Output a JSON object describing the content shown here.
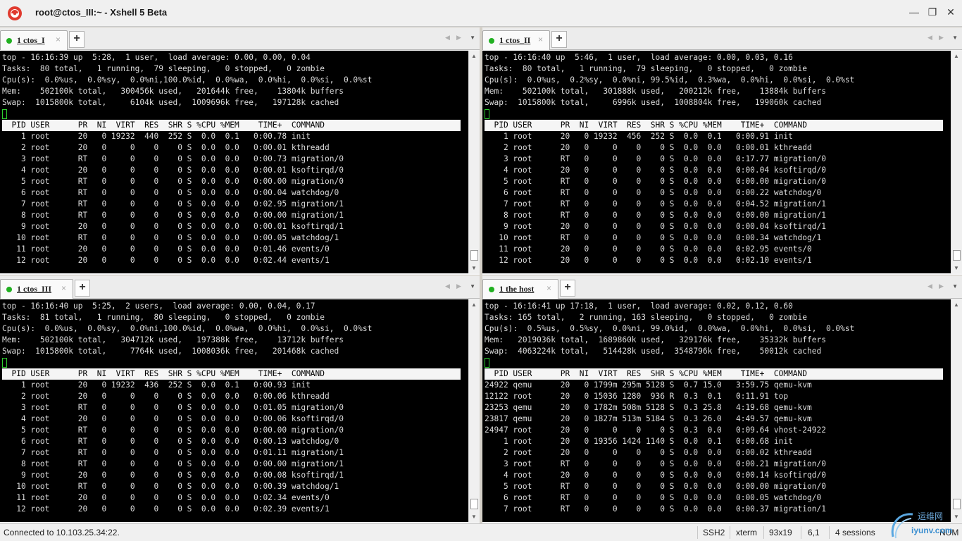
{
  "window": {
    "title": "root@ctos_III:~ - Xshell 5 Beta",
    "controls": {
      "minimize": "—",
      "restore": "❐",
      "close": "✕"
    }
  },
  "panes": [
    {
      "tab": {
        "label": "1 ctos_I",
        "close": "×",
        "add": "+"
      },
      "header": [
        "top - 16:16:39 up  5:28,  1 user,  load average: 0.00, 0.00, 0.04",
        "Tasks:  80 total,   1 running,  79 sleeping,   0 stopped,   0 zombie",
        "Cpu(s):  0.0%us,  0.0%sy,  0.0%ni,100.0%id,  0.0%wa,  0.0%hi,  0.0%si,  0.0%st",
        "Mem:    502100k total,   300456k used,   201644k free,    13804k buffers",
        "Swap:  1015800k total,     6104k used,  1009696k free,   197128k cached"
      ],
      "columns": "  PID USER      PR  NI  VIRT  RES  SHR S %CPU %MEM    TIME+  COMMAND",
      "rows": [
        "    1 root      20   0 19232  440  252 S  0.0  0.1   0:00.78 init",
        "    2 root      20   0     0    0    0 S  0.0  0.0   0:00.01 kthreadd",
        "    3 root      RT   0     0    0    0 S  0.0  0.0   0:00.73 migration/0",
        "    4 root      20   0     0    0    0 S  0.0  0.0   0:00.01 ksoftirqd/0",
        "    5 root      RT   0     0    0    0 S  0.0  0.0   0:00.00 migration/0",
        "    6 root      RT   0     0    0    0 S  0.0  0.0   0:00.04 watchdog/0",
        "    7 root      RT   0     0    0    0 S  0.0  0.0   0:02.95 migration/1",
        "    8 root      RT   0     0    0    0 S  0.0  0.0   0:00.00 migration/1",
        "    9 root      20   0     0    0    0 S  0.0  0.0   0:00.01 ksoftirqd/1",
        "   10 root      RT   0     0    0    0 S  0.0  0.0   0:00.05 watchdog/1",
        "   11 root      20   0     0    0    0 S  0.0  0.0   0:01.46 events/0",
        "   12 root      20   0     0    0    0 S  0.0  0.0   0:02.44 events/1"
      ]
    },
    {
      "tab": {
        "label": "1 ctos_II",
        "close": "×",
        "add": "+"
      },
      "header": [
        "top - 16:16:40 up  5:46,  1 user,  load average: 0.00, 0.03, 0.16",
        "Tasks:  80 total,   1 running,  79 sleeping,   0 stopped,   0 zombie",
        "Cpu(s):  0.0%us,  0.2%sy,  0.0%ni, 99.5%id,  0.3%wa,  0.0%hi,  0.0%si,  0.0%st",
        "Mem:    502100k total,   301888k used,   200212k free,    13884k buffers",
        "Swap:  1015800k total,     6996k used,  1008804k free,   199060k cached"
      ],
      "columns": "  PID USER      PR  NI  VIRT  RES  SHR S %CPU %MEM    TIME+  COMMAND",
      "rows": [
        "    1 root      20   0 19232  456  252 S  0.0  0.1   0:00.91 init",
        "    2 root      20   0     0    0    0 S  0.0  0.0   0:00.01 kthreadd",
        "    3 root      RT   0     0    0    0 S  0.0  0.0   0:17.77 migration/0",
        "    4 root      20   0     0    0    0 S  0.0  0.0   0:00.04 ksoftirqd/0",
        "    5 root      RT   0     0    0    0 S  0.0  0.0   0:00.00 migration/0",
        "    6 root      RT   0     0    0    0 S  0.0  0.0   0:00.22 watchdog/0",
        "    7 root      RT   0     0    0    0 S  0.0  0.0   0:04.52 migration/1",
        "    8 root      RT   0     0    0    0 S  0.0  0.0   0:00.00 migration/1",
        "    9 root      20   0     0    0    0 S  0.0  0.0   0:00.04 ksoftirqd/1",
        "   10 root      RT   0     0    0    0 S  0.0  0.0   0:00.34 watchdog/1",
        "   11 root      20   0     0    0    0 S  0.0  0.0   0:02.95 events/0",
        "   12 root      20   0     0    0    0 S  0.0  0.0   0:02.10 events/1"
      ]
    },
    {
      "tab": {
        "label": "1 ctos_III",
        "close": "×",
        "add": "+"
      },
      "header": [
        "top - 16:16:40 up  5:25,  2 users,  load average: 0.00, 0.04, 0.17",
        "Tasks:  81 total,   1 running,  80 sleeping,   0 stopped,   0 zombie",
        "Cpu(s):  0.0%us,  0.0%sy,  0.0%ni,100.0%id,  0.0%wa,  0.0%hi,  0.0%si,  0.0%st",
        "Mem:    502100k total,   304712k used,   197388k free,    13712k buffers",
        "Swap:  1015800k total,     7764k used,  1008036k free,   201468k cached"
      ],
      "columns": "  PID USER      PR  NI  VIRT  RES  SHR S %CPU %MEM    TIME+  COMMAND",
      "rows": [
        "    1 root      20   0 19232  436  252 S  0.0  0.1   0:00.93 init",
        "    2 root      20   0     0    0    0 S  0.0  0.0   0:00.06 kthreadd",
        "    3 root      RT   0     0    0    0 S  0.0  0.0   0:01.05 migration/0",
        "    4 root      20   0     0    0    0 S  0.0  0.0   0:00.06 ksoftirqd/0",
        "    5 root      RT   0     0    0    0 S  0.0  0.0   0:00.00 migration/0",
        "    6 root      RT   0     0    0    0 S  0.0  0.0   0:00.13 watchdog/0",
        "    7 root      RT   0     0    0    0 S  0.0  0.0   0:01.11 migration/1",
        "    8 root      RT   0     0    0    0 S  0.0  0.0   0:00.00 migration/1",
        "    9 root      20   0     0    0    0 S  0.0  0.0   0:00.08 ksoftirqd/1",
        "   10 root      RT   0     0    0    0 S  0.0  0.0   0:00.39 watchdog/1",
        "   11 root      20   0     0    0    0 S  0.0  0.0   0:02.34 events/0",
        "   12 root      20   0     0    0    0 S  0.0  0.0   0:02.39 events/1"
      ]
    },
    {
      "tab": {
        "label": "1 the host",
        "close": "×",
        "add": "+"
      },
      "header": [
        "top - 16:16:41 up 17:18,  1 user,  load average: 0.02, 0.12, 0.60",
        "Tasks: 165 total,   2 running, 163 sleeping,   0 stopped,   0 zombie",
        "Cpu(s):  0.5%us,  0.5%sy,  0.0%ni, 99.0%id,  0.0%wa,  0.0%hi,  0.0%si,  0.0%st",
        "Mem:   2019036k total,  1689860k used,   329176k free,    35332k buffers",
        "Swap:  4063224k total,   514428k used,  3548796k free,    50012k cached"
      ],
      "columns": "  PID USER      PR  NI  VIRT  RES  SHR S %CPU %MEM    TIME+  COMMAND",
      "rows": [
        "24922 qemu      20   0 1799m 295m 5128 S  0.7 15.0   3:59.75 qemu-kvm",
        "12122 root      20   0 15036 1280  936 R  0.3  0.1   0:11.91 top",
        "23253 qemu      20   0 1782m 508m 5128 S  0.3 25.8   4:19.68 qemu-kvm",
        "23817 qemu      20   0 1827m 513m 5184 S  0.3 26.0   4:49.57 qemu-kvm",
        "24947 root      20   0     0    0    0 S  0.3  0.0   0:09.64 vhost-24922",
        "    1 root      20   0 19356 1424 1140 S  0.0  0.1   0:00.68 init",
        "    2 root      20   0     0    0    0 S  0.0  0.0   0:00.02 kthreadd",
        "    3 root      RT   0     0    0    0 S  0.0  0.0   0:00.21 migration/0",
        "    4 root      20   0     0    0    0 S  0.0  0.0   0:00.14 ksoftirqd/0",
        "    5 root      RT   0     0    0    0 S  0.0  0.0   0:00.00 migration/0",
        "    6 root      RT   0     0    0    0 S  0.0  0.0   0:00.05 watchdog/0",
        "    7 root      RT   0     0    0    0 S  0.0  0.0   0:00.37 migration/1"
      ]
    }
  ],
  "status": {
    "connection": "Connected to 10.103.25.34:22.",
    "protocol": "SSH2",
    "terminal": "xterm",
    "size": "93x19",
    "cursor": "6,1",
    "sessions": "4 sessions",
    "num": "NUM"
  },
  "watermark": {
    "line1": "运维网",
    "line2": "iyunv.com"
  },
  "colors": {
    "tab_dot": "#21b021",
    "cursor": "#2ecc2e",
    "terminal_bg": "#000000"
  }
}
